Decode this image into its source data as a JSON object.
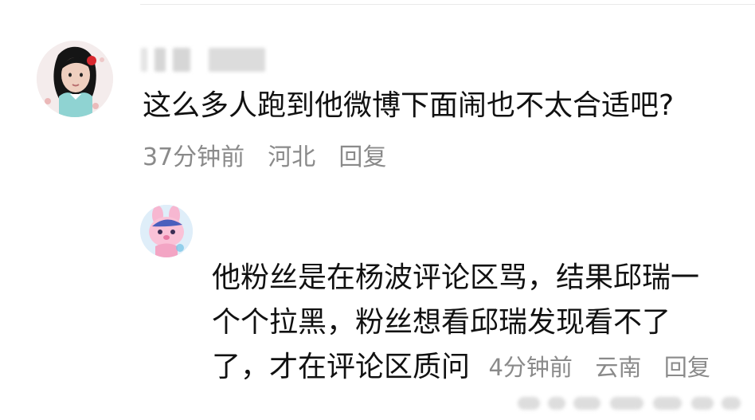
{
  "comment_thread": {
    "main_comment": {
      "text": "这么多人跑到他微博下面闹也不太合适吧?",
      "time": "37分钟前",
      "location": "河北",
      "reply_label": "回复"
    },
    "reply_comment": {
      "line1": "他粉丝是在杨波评论区骂，结果邱瑞一",
      "line2": "个个拉黑，粉丝想看邱瑞发现看不了",
      "line3": "了，才在评论区质问",
      "time": "4分钟前",
      "location": "云南",
      "reply_label": "回复"
    }
  },
  "icons": {
    "main_avatar": "avatar-girl-icon",
    "reply_avatar": "avatar-cartoon-icon"
  },
  "colors": {
    "text": "#111111",
    "meta": "#8a8a8a",
    "background": "#ffffff"
  }
}
